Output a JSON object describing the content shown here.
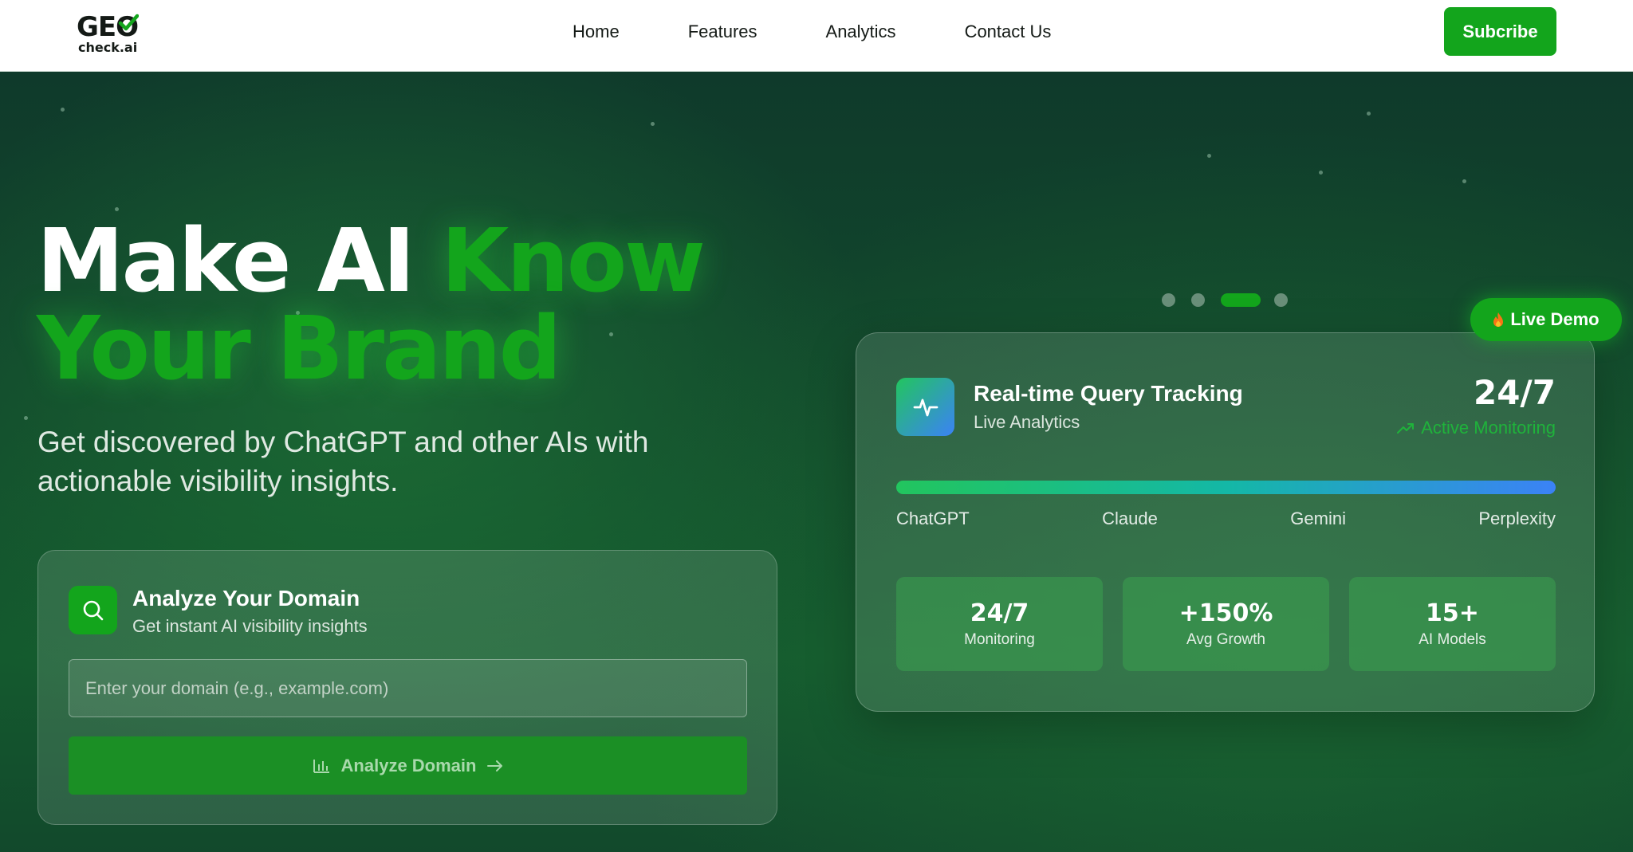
{
  "nav": {
    "logo_main": "GEO",
    "logo_sub": "check.ai",
    "links": [
      "Home",
      "Features",
      "Analytics",
      "Contact Us"
    ],
    "subscribe_label": "Subcribe"
  },
  "hero": {
    "headline_white": "Make AI ",
    "headline_green_1": "Know",
    "headline_green_2": "Your Brand",
    "subtitle": "Get discovered by ChatGPT and other AIs with actionable visibility insights."
  },
  "analyze_card": {
    "title": "Analyze Your Domain",
    "subtitle": "Get instant AI visibility insights",
    "input_placeholder": "Enter your domain (e.g., example.com)",
    "input_value": "",
    "button_label": "Analyze Domain",
    "icon": "search-icon"
  },
  "carousel": {
    "slides": 4,
    "active_index": 2
  },
  "live_demo": {
    "label": "Live Demo",
    "icon": "flame-icon"
  },
  "tracking_card": {
    "icon": "activity-icon",
    "title": "Real-time Query Tracking",
    "subtitle": "Live Analytics",
    "big_value": "24/7",
    "monitor_label": "Active Monitoring",
    "models": [
      "ChatGPT",
      "Claude",
      "Gemini",
      "Perplexity"
    ],
    "stats": [
      {
        "value": "24/7",
        "label": "Monitoring"
      },
      {
        "value": "+150%",
        "label": "Avg Growth"
      },
      {
        "value": "15+",
        "label": "AI Models"
      }
    ]
  },
  "colors": {
    "brand_green": "#13a51c",
    "hero_dark": "#0f3a2b",
    "gradient_start": "#22c55e",
    "gradient_end": "#3b82f6"
  }
}
